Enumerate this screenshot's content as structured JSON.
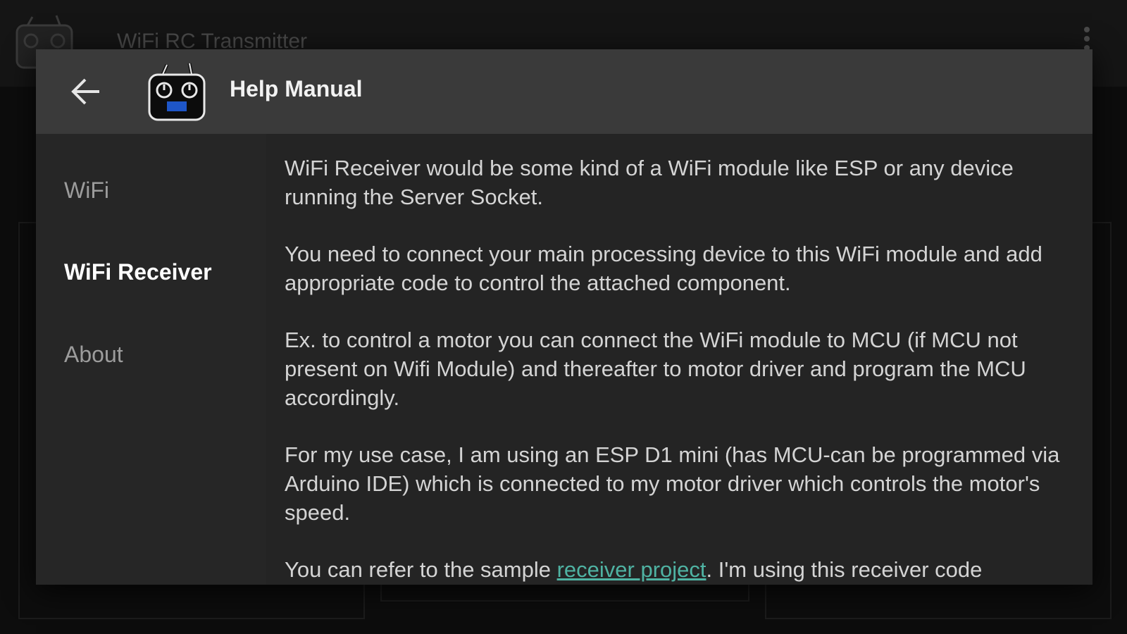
{
  "background_app": {
    "title": "WiFi RC Transmitter",
    "menu_icon": "overflow-menu-icon"
  },
  "dialog": {
    "title": "Help Manual",
    "back_icon": "arrow-left-icon",
    "logo_icon": "rc-transmitter-icon",
    "nav": [
      {
        "label": "WiFi",
        "active": false
      },
      {
        "label": "WiFi Receiver",
        "active": true
      },
      {
        "label": "About",
        "active": false
      }
    ],
    "paragraphs": [
      "WiFi Receiver would be some kind of a WiFi module like ESP or any device running the Server Socket.",
      "You need to connect your main processing device to this WiFi module and add appropriate code to control the attached component.",
      "Ex. to control a motor you can connect the WiFi module to MCU (if MCU not present on Wifi Module) and thereafter to motor driver and program the MCU accordingly.",
      "For my use case, I am using an ESP D1 mini (has MCU-can be programmed via Arduino IDE) which is connected to my motor driver which controls the motor's speed."
    ],
    "last_paragraph": {
      "before": "You can refer to the sample ",
      "link": "receiver project",
      "after": ". I'm using this receiver code"
    }
  },
  "colors": {
    "accent_link": "#4fb3a3",
    "logo_blue": "#1e56c8",
    "dialog_header": "#3a3a3a",
    "dialog_body": "#272727"
  }
}
